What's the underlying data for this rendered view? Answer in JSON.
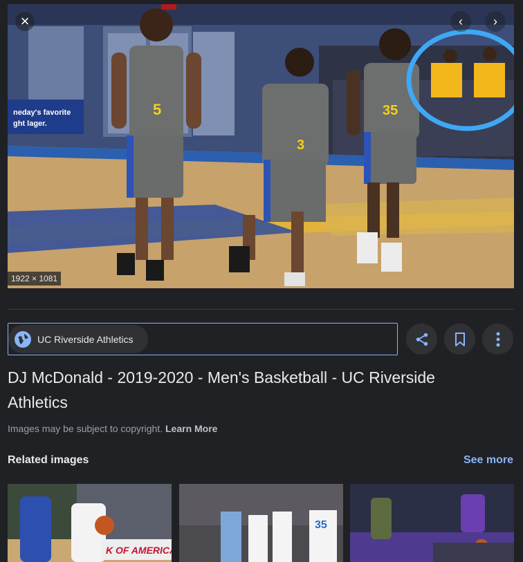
{
  "viewer": {
    "close_label": "×",
    "prev_label": "‹",
    "next_label": "›",
    "image_dimensions": "1922 × 1081",
    "image_alt": "Three UC Riverside basketball players in gray uniforms walking on court"
  },
  "source": {
    "name": "UC Riverside Athletics",
    "icon": "globe-icon"
  },
  "actions": [
    {
      "name": "share",
      "icon": "share-icon"
    },
    {
      "name": "save",
      "icon": "bookmark-icon"
    },
    {
      "name": "more",
      "icon": "more-vert-icon"
    }
  ],
  "result": {
    "title": "DJ McDonald - 2019-2020 - Men's Basketball - UC Riverside Athletics",
    "copyright_text": "Images may be subject to copyright.",
    "learn_more": "Learn More"
  },
  "related": {
    "heading": "Related images",
    "see_more": "See more",
    "banner_text": "K OF AMERICA",
    "jersey_number": "35"
  },
  "colors": {
    "background": "#202124",
    "accent": "#8ab4f8",
    "annotation_circle": "#3fa8f5"
  }
}
